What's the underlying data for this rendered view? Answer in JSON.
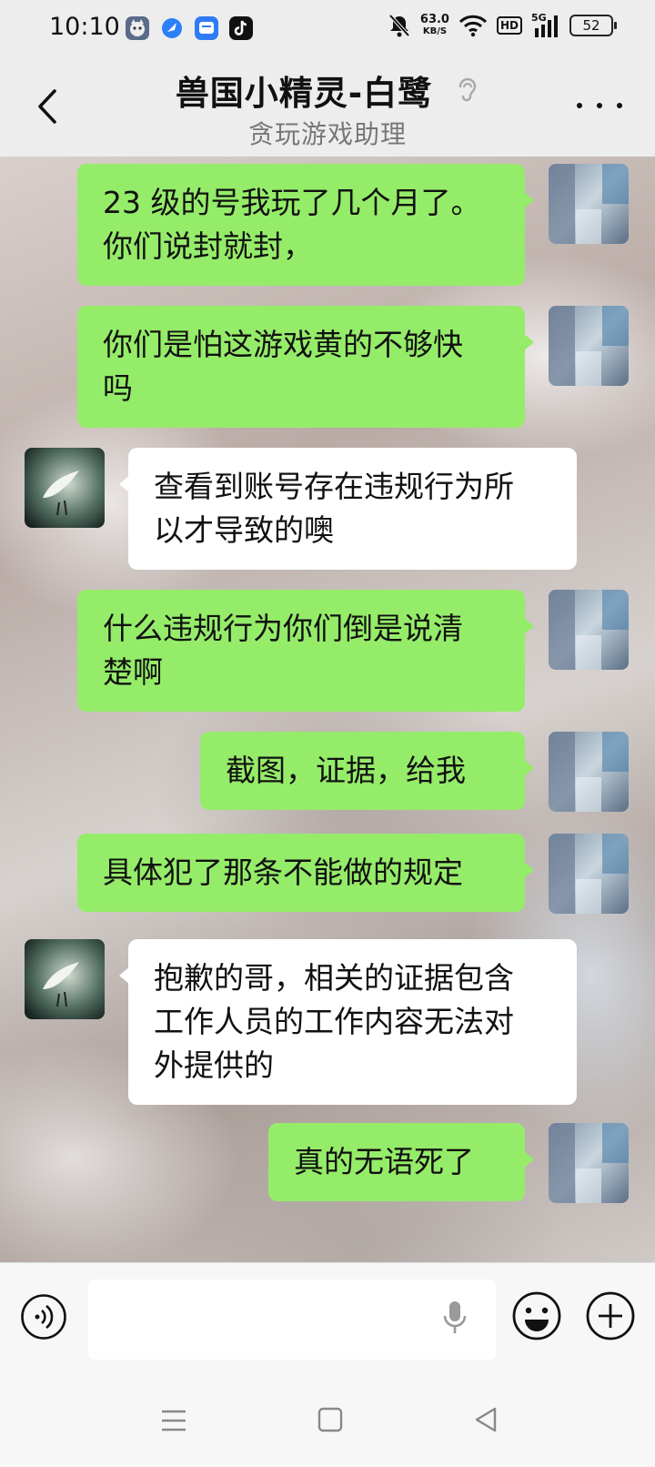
{
  "status_bar": {
    "time": "10:10",
    "network_speed_value": "63.0",
    "network_speed_unit": "KB/S",
    "hd_label": "HD",
    "signal_label": "5G",
    "battery": "52",
    "icons": [
      "cat-app-icon",
      "blue-app-icon",
      "message-app-icon",
      "tiktok-icon",
      "mute-icon",
      "wifi-icon",
      "signal-icon",
      "battery-icon"
    ]
  },
  "header": {
    "title": "兽国小精灵-白鹭",
    "subtitle": "贪玩游戏助理",
    "icons": [
      "back-chevron-icon",
      "ear-icon",
      "more-dots-icon"
    ]
  },
  "messages": [
    {
      "side": "me",
      "lines": [
        "23 级的号我玩了几个月了。",
        "你们说封就封，"
      ]
    },
    {
      "side": "me",
      "lines": [
        "你们是怕这游戏黄的不够快",
        "吗"
      ]
    },
    {
      "side": "them",
      "lines": [
        "查看到账号存在违规行为所",
        "以才导致的噢"
      ]
    },
    {
      "side": "me",
      "lines": [
        "什么违规行为你们倒是说清",
        "楚啊"
      ]
    },
    {
      "side": "me",
      "lines": [
        "截图，证据，给我"
      ]
    },
    {
      "side": "me",
      "lines": [
        "具体犯了那条不能做的规定"
      ]
    },
    {
      "side": "them",
      "lines": [
        "抱歉的哥，相关的证据包含",
        "工作人员的工作内容无法对",
        "外提供的"
      ]
    },
    {
      "side": "me",
      "lines": [
        "真的无语死了"
      ]
    }
  ],
  "input_bar": {
    "text_value": "",
    "icons": [
      "voice-icon",
      "mic-icon",
      "emoji-icon",
      "plus-icon"
    ]
  },
  "nav_bar": {
    "icons": [
      "menu-icon",
      "home-square-icon",
      "back-triangle-icon"
    ]
  },
  "colors": {
    "outgoing_bubble": "#95ec69",
    "incoming_bubble": "#ffffff",
    "bar_background": "#ededed"
  }
}
